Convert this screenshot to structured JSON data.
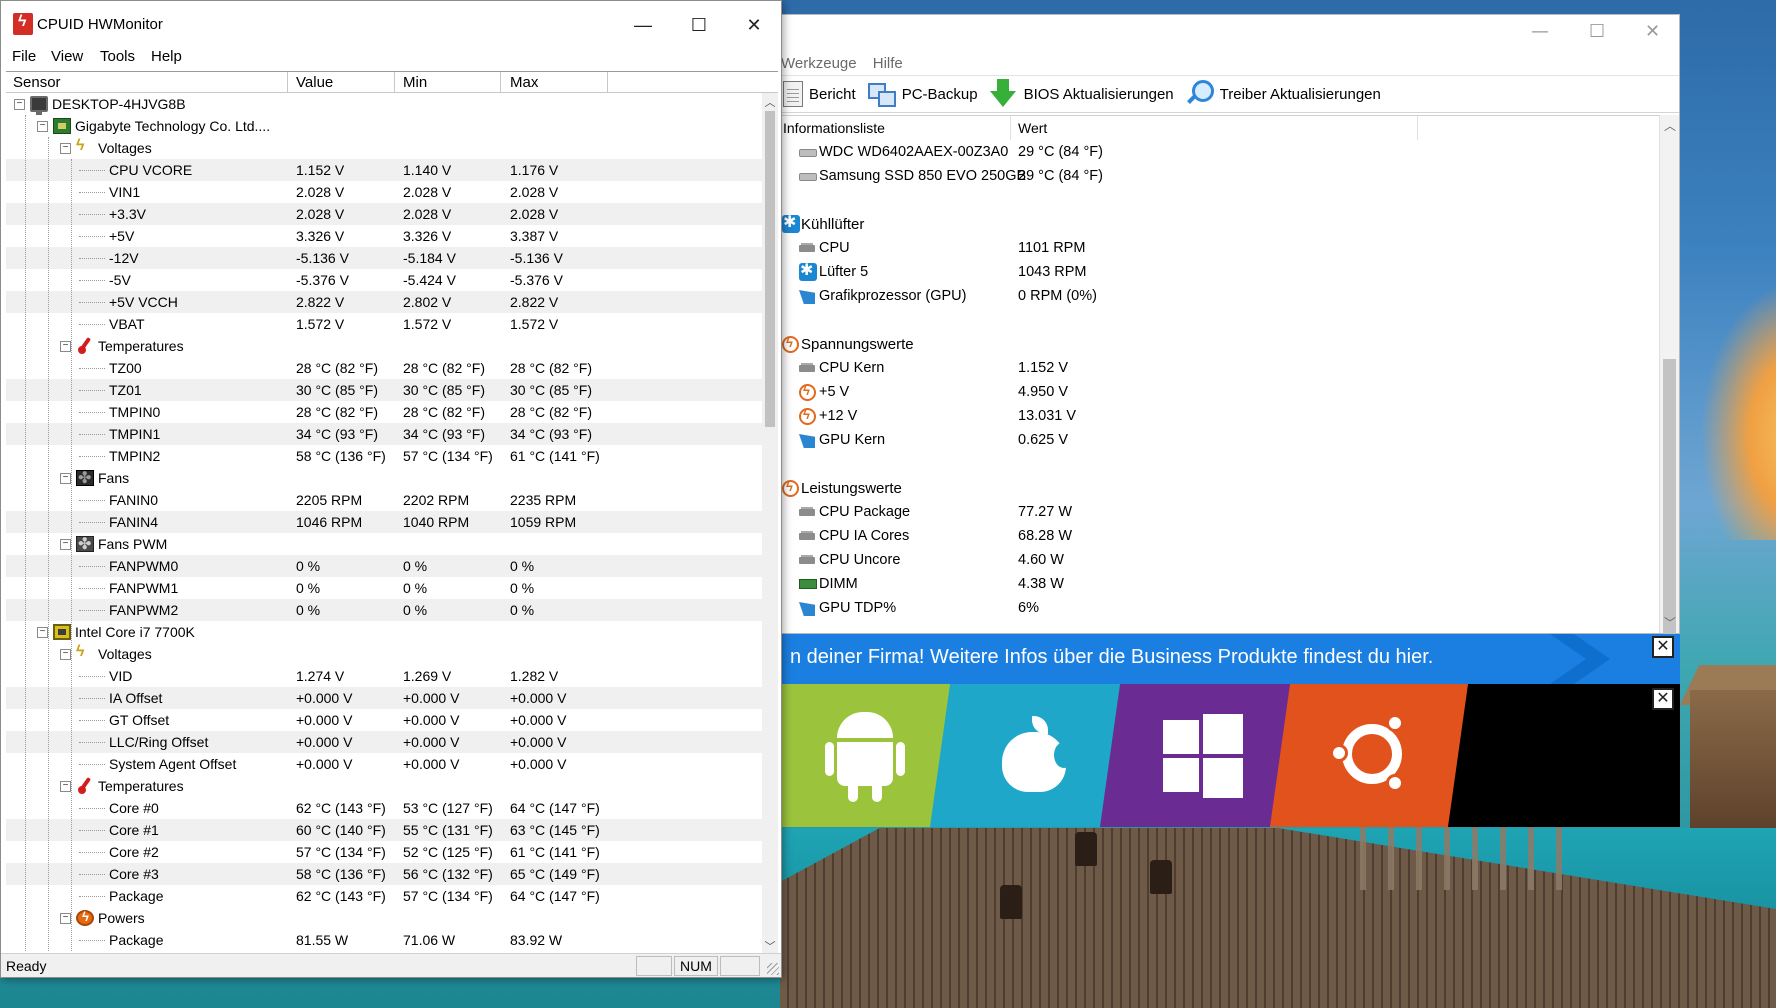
{
  "hwmonitor": {
    "title": "CPUID HWMonitor",
    "menu": [
      "File",
      "View",
      "Tools",
      "Help"
    ],
    "columns": [
      "Sensor",
      "Value",
      "Min",
      "Max"
    ],
    "status": "Ready",
    "num_indicator": "NUM",
    "rows": [
      {
        "level": 0,
        "kind": "node",
        "icon": "computer-icon",
        "name": "DESKTOP-4HJVG8B"
      },
      {
        "level": 1,
        "kind": "node",
        "icon": "motherboard-icon",
        "name": "Gigabyte Technology Co. Ltd...."
      },
      {
        "level": 2,
        "kind": "node",
        "icon": "voltage-icon",
        "name": "Voltages"
      },
      {
        "level": 3,
        "kind": "leaf",
        "name": "CPU VCORE",
        "value": "1.152 V",
        "min": "1.140 V",
        "max": "1.176 V"
      },
      {
        "level": 3,
        "kind": "leaf",
        "name": "VIN1",
        "value": "2.028 V",
        "min": "2.028 V",
        "max": "2.028 V"
      },
      {
        "level": 3,
        "kind": "leaf",
        "name": "+3.3V",
        "value": "2.028 V",
        "min": "2.028 V",
        "max": "2.028 V"
      },
      {
        "level": 3,
        "kind": "leaf",
        "name": "+5V",
        "value": "3.326 V",
        "min": "3.326 V",
        "max": "3.387 V"
      },
      {
        "level": 3,
        "kind": "leaf",
        "name": "-12V",
        "value": "-5.136 V",
        "min": "-5.184 V",
        "max": "-5.136 V"
      },
      {
        "level": 3,
        "kind": "leaf",
        "name": "-5V",
        "value": "-5.376 V",
        "min": "-5.424 V",
        "max": "-5.376 V"
      },
      {
        "level": 3,
        "kind": "leaf",
        "name": "+5V VCCH",
        "value": "2.822 V",
        "min": "2.802 V",
        "max": "2.822 V"
      },
      {
        "level": 3,
        "kind": "leaf",
        "name": "VBAT",
        "value": "1.572 V",
        "min": "1.572 V",
        "max": "1.572 V"
      },
      {
        "level": 2,
        "kind": "node",
        "icon": "thermometer-icon",
        "name": "Temperatures"
      },
      {
        "level": 3,
        "kind": "leaf",
        "name": "TZ00",
        "value": "28 °C  (82 °F)",
        "min": "28 °C  (82 °F)",
        "max": "28 °C  (82 °F)"
      },
      {
        "level": 3,
        "kind": "leaf",
        "name": "TZ01",
        "value": "30 °C  (85 °F)",
        "min": "30 °C  (85 °F)",
        "max": "30 °C  (85 °F)"
      },
      {
        "level": 3,
        "kind": "leaf",
        "name": "TMPIN0",
        "value": "28 °C  (82 °F)",
        "min": "28 °C  (82 °F)",
        "max": "28 °C  (82 °F)"
      },
      {
        "level": 3,
        "kind": "leaf",
        "name": "TMPIN1",
        "value": "34 °C  (93 °F)",
        "min": "34 °C  (93 °F)",
        "max": "34 °C  (93 °F)"
      },
      {
        "level": 3,
        "kind": "leaf",
        "name": "TMPIN2",
        "value": "58 °C  (136 °F)",
        "min": "57 °C  (134 °F)",
        "max": "61 °C  (141 °F)"
      },
      {
        "level": 2,
        "kind": "node",
        "icon": "fan-icon",
        "name": "Fans"
      },
      {
        "level": 3,
        "kind": "leaf",
        "name": "FANIN0",
        "value": "2205 RPM",
        "min": "2202 RPM",
        "max": "2235 RPM"
      },
      {
        "level": 3,
        "kind": "leaf",
        "name": "FANIN4",
        "value": "1046 RPM",
        "min": "1040 RPM",
        "max": "1059 RPM"
      },
      {
        "level": 2,
        "kind": "node",
        "icon": "fan-pwm-icon",
        "name": "Fans PWM"
      },
      {
        "level": 3,
        "kind": "leaf",
        "name": "FANPWM0",
        "value": "0 %",
        "min": "0 %",
        "max": "0 %"
      },
      {
        "level": 3,
        "kind": "leaf",
        "name": "FANPWM1",
        "value": "0 %",
        "min": "0 %",
        "max": "0 %"
      },
      {
        "level": 3,
        "kind": "leaf",
        "name": "FANPWM2",
        "value": "0 %",
        "min": "0 %",
        "max": "0 %"
      },
      {
        "level": 1,
        "kind": "node",
        "icon": "cpu-icon",
        "name": "Intel Core i7 7700K"
      },
      {
        "level": 2,
        "kind": "node",
        "icon": "voltage-icon",
        "name": "Voltages"
      },
      {
        "level": 3,
        "kind": "leaf",
        "name": "VID",
        "value": "1.274 V",
        "min": "1.269 V",
        "max": "1.282 V"
      },
      {
        "level": 3,
        "kind": "leaf",
        "name": "IA Offset",
        "value": "+0.000 V",
        "min": "+0.000 V",
        "max": "+0.000 V"
      },
      {
        "level": 3,
        "kind": "leaf",
        "name": "GT Offset",
        "value": "+0.000 V",
        "min": "+0.000 V",
        "max": "+0.000 V"
      },
      {
        "level": 3,
        "kind": "leaf",
        "name": "LLC/Ring Offset",
        "value": "+0.000 V",
        "min": "+0.000 V",
        "max": "+0.000 V"
      },
      {
        "level": 3,
        "kind": "leaf",
        "name": "System Agent Offset",
        "value": "+0.000 V",
        "min": "+0.000 V",
        "max": "+0.000 V"
      },
      {
        "level": 2,
        "kind": "node",
        "icon": "thermometer-icon",
        "name": "Temperatures"
      },
      {
        "level": 3,
        "kind": "leaf",
        "name": "Core #0",
        "value": "62 °C  (143 °F)",
        "min": "53 °C  (127 °F)",
        "max": "64 °C  (147 °F)"
      },
      {
        "level": 3,
        "kind": "leaf",
        "name": "Core #1",
        "value": "60 °C  (140 °F)",
        "min": "55 °C  (131 °F)",
        "max": "63 °C  (145 °F)"
      },
      {
        "level": 3,
        "kind": "leaf",
        "name": "Core #2",
        "value": "57 °C  (134 °F)",
        "min": "52 °C  (125 °F)",
        "max": "61 °C  (141 °F)"
      },
      {
        "level": 3,
        "kind": "leaf",
        "name": "Core #3",
        "value": "58 °C  (136 °F)",
        "min": "56 °C  (132 °F)",
        "max": "65 °C  (149 °F)"
      },
      {
        "level": 3,
        "kind": "leaf",
        "name": "Package",
        "value": "62 °C  (143 °F)",
        "min": "57 °C  (134 °F)",
        "max": "64 °C  (147 °F)"
      },
      {
        "level": 2,
        "kind": "node",
        "icon": "power-icon",
        "name": "Powers"
      },
      {
        "level": 3,
        "kind": "leaf",
        "name": "Package",
        "value": "81.55 W",
        "min": "71.06 W",
        "max": "83.92 W"
      }
    ]
  },
  "background_window": {
    "menu": [
      "Werkzeuge",
      "Hilfe"
    ],
    "toolbar": [
      {
        "label": "Bericht",
        "icon": "report-icon"
      },
      {
        "label": "PC-Backup",
        "icon": "backup-icon"
      },
      {
        "label": "BIOS Aktualisierungen",
        "icon": "download-arrow-icon"
      },
      {
        "label": "Treiber Aktualisierungen",
        "icon": "magnifier-icon"
      }
    ],
    "columns": [
      "Informationsliste",
      "Wert"
    ],
    "rows": [
      {
        "type": "item",
        "icon": "disk-icon",
        "label": "WDC WD6402AAEX-00Z3A0",
        "value": "29 °C  (84 °F)"
      },
      {
        "type": "item",
        "icon": "disk-icon",
        "label": "Samsung SSD 850 EVO 250GB",
        "value": "29 °C  (84 °F)"
      },
      {
        "type": "blank"
      },
      {
        "type": "group",
        "icon": "fan-icon",
        "label": "Kühllüfter"
      },
      {
        "type": "item",
        "icon": "chip-icon",
        "label": "CPU",
        "value": "1101 RPM"
      },
      {
        "type": "item",
        "icon": "fan-icon",
        "label": "Lüfter 5",
        "value": "1043 RPM"
      },
      {
        "type": "item",
        "icon": "gpu-icon",
        "label": "Grafikprozessor (GPU)",
        "value": "0 RPM  (0%)"
      },
      {
        "type": "blank"
      },
      {
        "type": "group",
        "icon": "bolt-icon",
        "label": "Spannungswerte"
      },
      {
        "type": "item",
        "icon": "chip-icon",
        "label": "CPU Kern",
        "value": "1.152 V"
      },
      {
        "type": "item",
        "icon": "bolt-icon",
        "label": "+5 V",
        "value": "4.950 V"
      },
      {
        "type": "item",
        "icon": "bolt-icon",
        "label": "+12 V",
        "value": "13.031 V"
      },
      {
        "type": "item",
        "icon": "gpu-icon",
        "label": "GPU Kern",
        "value": "0.625 V"
      },
      {
        "type": "blank"
      },
      {
        "type": "group",
        "icon": "bolt-icon",
        "label": "Leistungswerte"
      },
      {
        "type": "item",
        "icon": "chip-icon",
        "label": "CPU Package",
        "value": "77.27 W"
      },
      {
        "type": "item",
        "icon": "chip-icon",
        "label": "CPU IA Cores",
        "value": "68.28 W"
      },
      {
        "type": "item",
        "icon": "chip-icon",
        "label": "CPU Uncore",
        "value": "4.60 W"
      },
      {
        "type": "item",
        "icon": "dimm-icon",
        "label": "DIMM",
        "value": "4.38 W"
      },
      {
        "type": "item",
        "icon": "gpu-icon",
        "label": "GPU TDP%",
        "value": "6%"
      }
    ]
  },
  "ad_banner": {
    "text": "n deiner Firma! Weitere Infos über die Business Produkte findest du hier.",
    "close_label": "✕",
    "os_tiles": [
      {
        "name": "android",
        "color": "#9bc43c"
      },
      {
        "name": "apple",
        "color": "#1ea7c9"
      },
      {
        "name": "windows",
        "color": "#6a2c92"
      },
      {
        "name": "ubuntu",
        "color": "#e2521d"
      }
    ]
  },
  "icons": {
    "minimize": "—",
    "maximize": "☐",
    "close": "✕",
    "scroll_up": "︿",
    "scroll_down": "﹀"
  }
}
